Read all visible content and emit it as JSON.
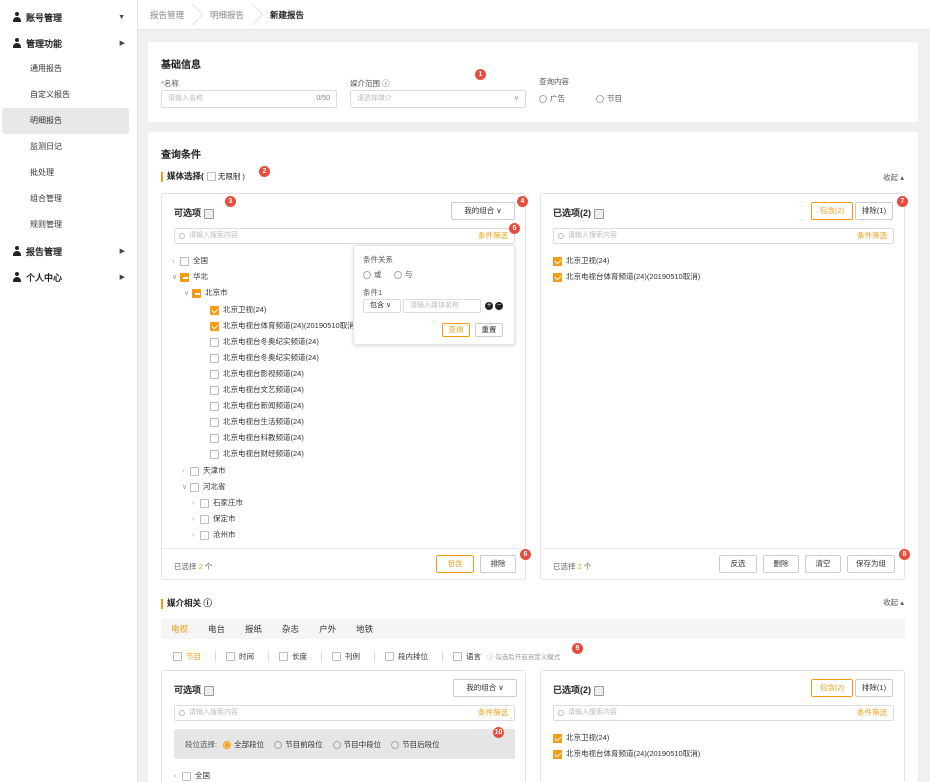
{
  "sidebar": {
    "groups": [
      {
        "label": "账号管理",
        "arrow": "▼"
      },
      {
        "label": "管理功能",
        "arrow": "▶"
      },
      {
        "label": "报告管理",
        "arrow": "▶"
      },
      {
        "label": "个人中心",
        "arrow": "▶"
      }
    ],
    "items": [
      "通用报告",
      "自定义报告",
      "明细报告",
      "监测日记",
      "批处理",
      "组合管理",
      "规则管理"
    ]
  },
  "breadcrumb": [
    "报告管理",
    "明细报告",
    "新建报告"
  ],
  "basic": {
    "title": "基础信息",
    "name_label": "名称",
    "required_mark": "*",
    "name_placeholder": "请输入名称",
    "name_count": "0/50",
    "media_label": "媒介范围 ⓘ",
    "media_placeholder": "请选择媒介",
    "query_label": "查询内容",
    "opt_ad": "广告",
    "opt_program": "节目"
  },
  "query": {
    "title": "查询条件",
    "media_select_label": "媒体选择(",
    "unlimited": "无限制 )",
    "collapse": "收起 ▴",
    "left": {
      "title": "可选项",
      "my_combo": "我的组合 ∨",
      "search_placeholder": "请输入搜索内容",
      "filter": "条件筛选",
      "tree": [
        {
          "label": "全国",
          "chk": "none",
          "tri": "›"
        },
        {
          "label": "华北",
          "chk": "half",
          "tri": "∨"
        },
        {
          "label": "北京市",
          "chk": "half",
          "tri": "∨"
        },
        {
          "label": "北京卫视(24)",
          "chk": "on",
          "tri": ""
        },
        {
          "label": "北京电视台体育频道(24)(20190510取消",
          "chk": "on",
          "tri": ""
        },
        {
          "label": "北京电视台冬奥纪实频道(24)",
          "chk": "none",
          "tri": ""
        },
        {
          "label": "北京电视台冬奥纪实频道(24)",
          "chk": "none",
          "tri": ""
        },
        {
          "label": "北京电视台影视频道(24)",
          "chk": "none",
          "tri": ""
        },
        {
          "label": "北京电视台文艺频道(24)",
          "chk": "none",
          "tri": ""
        },
        {
          "label": "北京电视台新闻频道(24)",
          "chk": "none",
          "tri": ""
        },
        {
          "label": "北京电视台生活频道(24)",
          "chk": "none",
          "tri": ""
        },
        {
          "label": "北京电视台科教频道(24)",
          "chk": "none",
          "tri": ""
        },
        {
          "label": "北京电视台财经频道(24)",
          "chk": "none",
          "tri": ""
        },
        {
          "label": "天津市",
          "chk": "none",
          "tri": "›"
        },
        {
          "label": "河北省",
          "chk": "none",
          "tri": "∨"
        },
        {
          "label": "石家庄市",
          "chk": "none",
          "tri": "›"
        },
        {
          "label": "保定市",
          "chk": "none",
          "tri": "›"
        },
        {
          "label": "沧州市",
          "chk": "none",
          "tri": "›"
        }
      ],
      "selected_prefix": "已选择",
      "selected_count": "2",
      "selected_suffix": "个",
      "include_btn": "包含",
      "exclude_btn": "排除"
    },
    "popup": {
      "relation_label": "条件关系",
      "or": "或",
      "and": "与",
      "cond_label": "条件1",
      "contains": "包含 ∨",
      "cond_placeholder": "请输入媒体名称",
      "query_btn": "查询",
      "reset_btn": "重置"
    },
    "right": {
      "title": "已选项(2)",
      "tab_include": "包含(2)",
      "tab_exclude": "排除(1)",
      "search_placeholder": "请输入搜索内容",
      "filter": "条件筛选",
      "items": [
        "北京卫视(24)",
        "北京电视台体育频道(24)(20190510取消)"
      ],
      "selected_prefix": "已选择",
      "selected_count": "2",
      "selected_suffix": "个",
      "btn_invert": "反选",
      "btn_delete": "删除",
      "btn_clear": "清空",
      "btn_save": "保存为组"
    }
  },
  "media_related": {
    "title": "媒介相关 ⓘ",
    "collapse": "收起 ▴",
    "tabs": [
      "电视",
      "电台",
      "报纸",
      "杂志",
      "户外",
      "地铁"
    ],
    "fields": [
      "节目",
      "时间",
      "长度",
      "刊例",
      "段内排位",
      "语言"
    ],
    "hint": "ⓘ 勾选后开启自定义模式",
    "left": {
      "title": "可选项",
      "my_combo": "我的组合 ∨",
      "search_placeholder": "请输入搜索内容",
      "filter": "条件筛选",
      "segment_label": "段位选择:",
      "segments": [
        "全部段位",
        "节目前段位",
        "节目中段位",
        "节目后段位"
      ],
      "first_tree": "全国"
    },
    "right": {
      "title": "已选项(2)",
      "tab_include": "包含(2)",
      "tab_exclude": "排除(1)",
      "search_placeholder": "请输入搜索内容",
      "filter": "条件筛选",
      "items": [
        "北京卫视(24)",
        "北京电视台体育频道(24)(20190510取消)"
      ]
    }
  },
  "badges": [
    "1",
    "2",
    "3",
    "4",
    "5",
    "6",
    "7",
    "8",
    "9",
    "10"
  ],
  "colors": {
    "accent": "#f39c12",
    "badge": "#e74c3c"
  }
}
